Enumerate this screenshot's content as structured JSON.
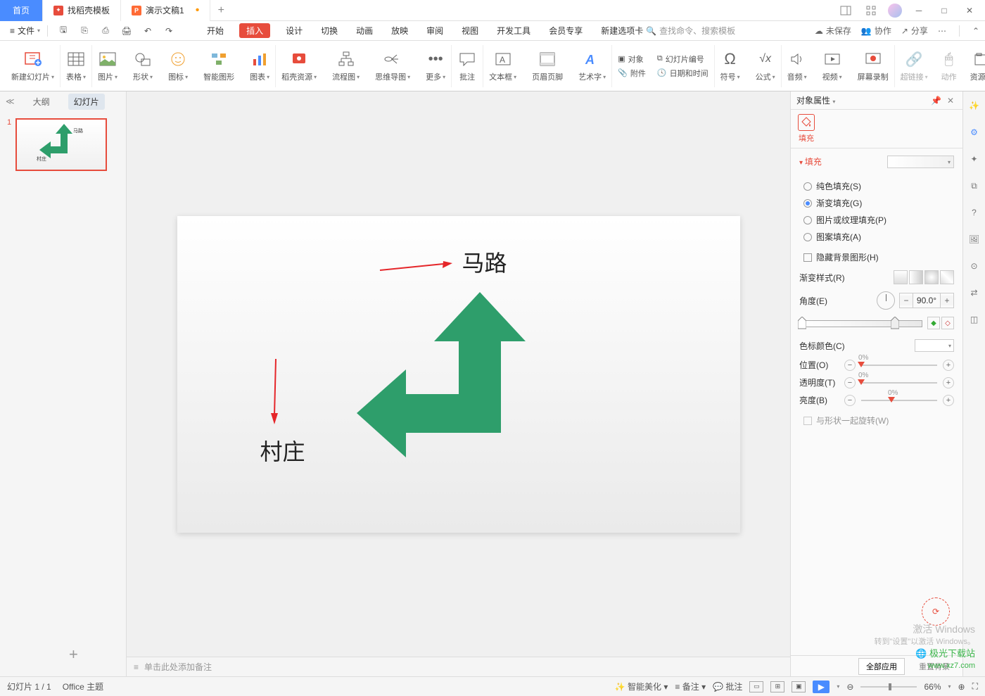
{
  "tabs": {
    "home": "首页",
    "template": "找稻壳模板",
    "doc": "演示文稿1"
  },
  "file_menu": "文件",
  "menu": [
    "开始",
    "插入",
    "设计",
    "切换",
    "动画",
    "放映",
    "审阅",
    "视图",
    "开发工具",
    "会员专享",
    "新建选项卡"
  ],
  "menu_active_index": 1,
  "search_placeholder": "查找命令、搜索模板",
  "cloud": {
    "unsaved": "未保存",
    "collab": "协作",
    "share": "分享"
  },
  "ribbon": {
    "new_slide": "新建幻灯片",
    "table": "表格",
    "image": "图片",
    "shape": "形状",
    "icon": "图标",
    "smart": "智能图形",
    "chart": "图表",
    "template_res": "稻壳资源",
    "flowchart": "流程图",
    "mindmap": "思维导图",
    "more": "更多",
    "annotate": "批注",
    "textbox": "文本框",
    "header_footer": "页眉页脚",
    "wordart": "艺术字",
    "object": "对象",
    "attachment": "附件",
    "slide_number": "幻灯片编号",
    "date_time": "日期和时间",
    "symbol": "符号",
    "formula": "公式",
    "audio": "音频",
    "video": "视频",
    "screen_record": "屏幕录制",
    "hyperlink": "超链接",
    "action": "动作",
    "resource": "资源夹"
  },
  "thumb": {
    "outline": "大纲",
    "slides": "幻灯片",
    "num": "1"
  },
  "slide": {
    "road": "马路",
    "village": "村庄"
  },
  "notes_placeholder": "单击此处添加备注",
  "props": {
    "title": "对象属性",
    "tab_fill": "填充",
    "section_fill": "填充",
    "fill_solid": "纯色填充(S)",
    "fill_gradient": "渐变填充(G)",
    "fill_picture": "图片或纹理填充(P)",
    "fill_pattern": "图案填充(A)",
    "hide_bg": "隐藏背景图形(H)",
    "gradient_style": "渐变样式(R)",
    "angle": "角度(E)",
    "angle_value": "90.0°",
    "stop_color": "色标颜色(C)",
    "position": "位置(O)",
    "position_val": "0%",
    "transparency": "透明度(T)",
    "transparency_val": "0%",
    "brightness": "亮度(B)",
    "brightness_val": "0%",
    "rotate_with_shape": "与形状一起旋转(W)",
    "apply_all": "全部应用",
    "reset_bg": "重置背景"
  },
  "status": {
    "slide_count": "幻灯片 1 / 1",
    "theme": "Office 主题",
    "beautify": "智能美化",
    "notes": "备注",
    "annotate": "批注",
    "zoom": "66%"
  },
  "watermark": {
    "line1": "激活 Windows",
    "line2": "转到\"设置\"以激活 Windows。",
    "logo": "极光下载站",
    "url": "www.xz7.com"
  }
}
